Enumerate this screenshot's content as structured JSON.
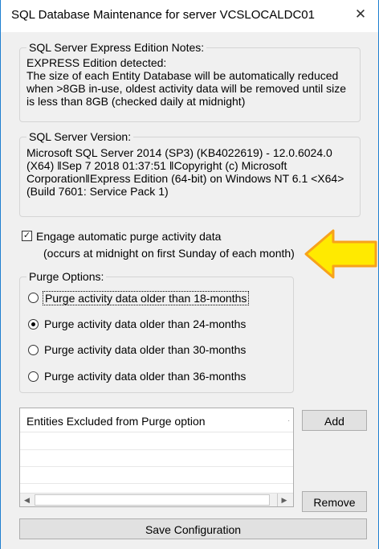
{
  "window": {
    "title": "SQL Database Maintenance for server VCSLOCALDC01",
    "close_glyph": "✕"
  },
  "notes_group": {
    "label": "SQL Server Express Edition Notes:",
    "text": "EXPRESS Edition detected:\nThe size of each Entity Database will be automatically reduced\nwhen >8GB in-use, oldest activity data will be removed until size\nis less than 8GB (checked daily at midnight)"
  },
  "version_group": {
    "label": "SQL Server Version:",
    "text": "Microsoft SQL Server 2014 (SP3) (KB4022619) - 12.0.6024.0\n(X64) ‖Sep  7 2018 01:37:51 ‖Copyright (c) Microsoft\nCorporation‖Express Edition (64-bit) on Windows NT 6.1 <X64>\n(Build 7601: Service Pack 1)"
  },
  "auto_purge": {
    "label": "Engage automatic purge activity data",
    "sublabel": "(occurs at midnight on first Sunday of each month)",
    "checked": true,
    "check_glyph": "✓"
  },
  "purge_options": {
    "label": "Purge Options:",
    "options": [
      {
        "label": "Purge activity data older than 18-months",
        "selected": false,
        "focused": true
      },
      {
        "label": "Purge activity data older than 24-months",
        "selected": true,
        "focused": false
      },
      {
        "label": "Purge activity data older than 30-months",
        "selected": false,
        "focused": false
      },
      {
        "label": "Purge activity data older than 36-months",
        "selected": false,
        "focused": false
      }
    ]
  },
  "excluded_list": {
    "header": "Entities Excluded from Purge option",
    "rows": [],
    "scroll_left_glyph": "◀",
    "scroll_right_glyph": "▶"
  },
  "buttons": {
    "add": "Add",
    "remove": "Remove",
    "save": "Save Configuration"
  },
  "annotation": {
    "arrow_fill": "#ffea00",
    "arrow_stroke": "#f7a21b"
  }
}
